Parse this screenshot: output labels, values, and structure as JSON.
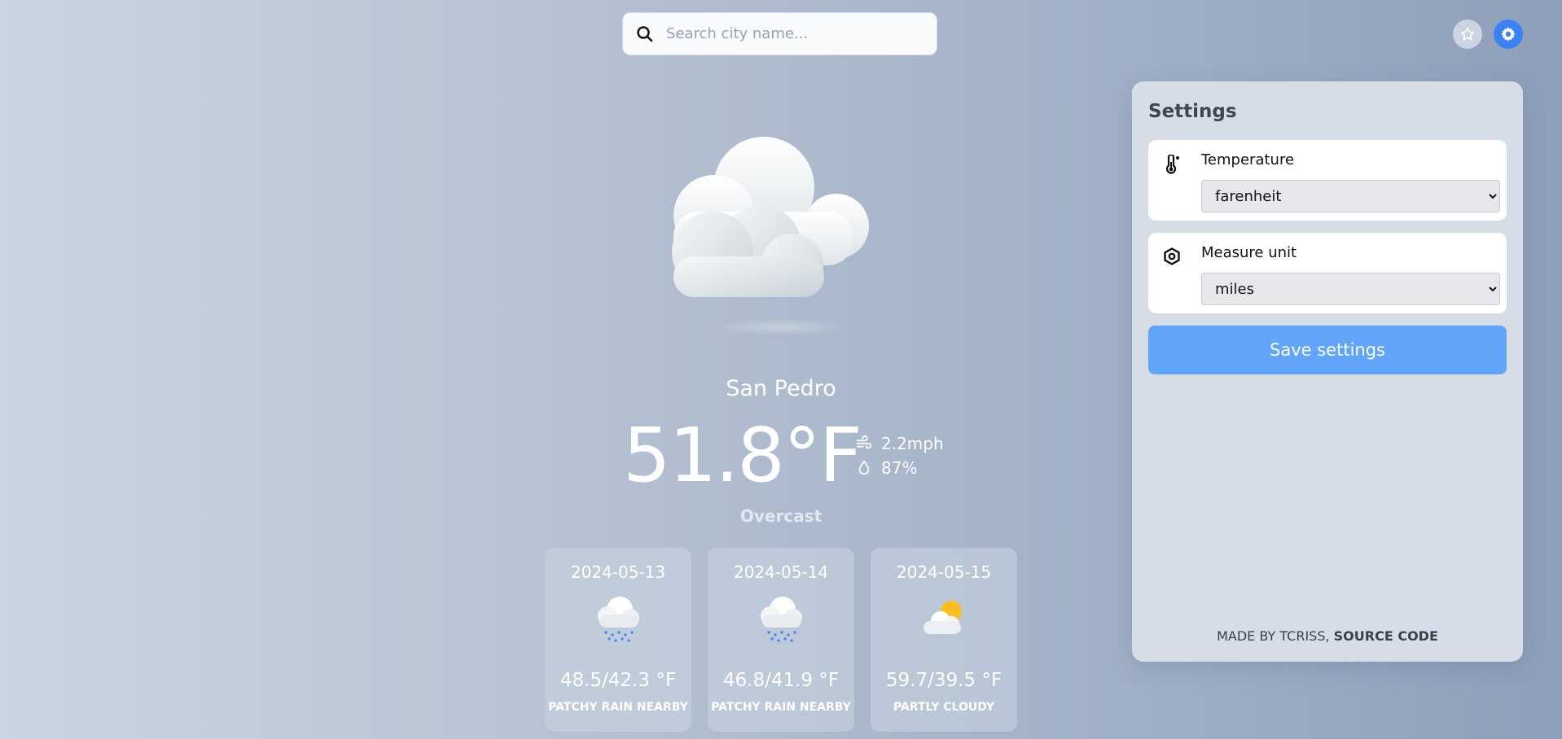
{
  "search": {
    "placeholder": "Search city name..."
  },
  "header": {
    "favorites_icon": "star-icon",
    "settings_icon": "gear-icon"
  },
  "current": {
    "city": "San Pedro",
    "temperature": "51.8°F",
    "wind": "2.2mph",
    "humidity": "87%",
    "condition": "Overcast",
    "icon": "cloud-icon"
  },
  "forecast": [
    {
      "date": "2024-05-13",
      "range": "48.5/42.3 °F",
      "desc": "PATCHY RAIN NEARBY",
      "icon": "rain-cloud-icon"
    },
    {
      "date": "2024-05-14",
      "range": "46.8/41.9 °F",
      "desc": "PATCHY RAIN NEARBY",
      "icon": "rain-cloud-icon"
    },
    {
      "date": "2024-05-15",
      "range": "59.7/39.5 °F",
      "desc": "PARTLY CLOUDY",
      "icon": "partly-cloudy-icon"
    }
  ],
  "settings": {
    "title": "Settings",
    "temperature": {
      "label": "Temperature",
      "value": "farenheit"
    },
    "measure": {
      "label": "Measure unit",
      "value": "miles"
    },
    "save_label": "Save settings",
    "credits_prefix": "MADE BY TCRISS, ",
    "credits_link": "SOURCE CODE"
  },
  "colors": {
    "accent": "#3b82f6",
    "button": "#60a5fa"
  }
}
